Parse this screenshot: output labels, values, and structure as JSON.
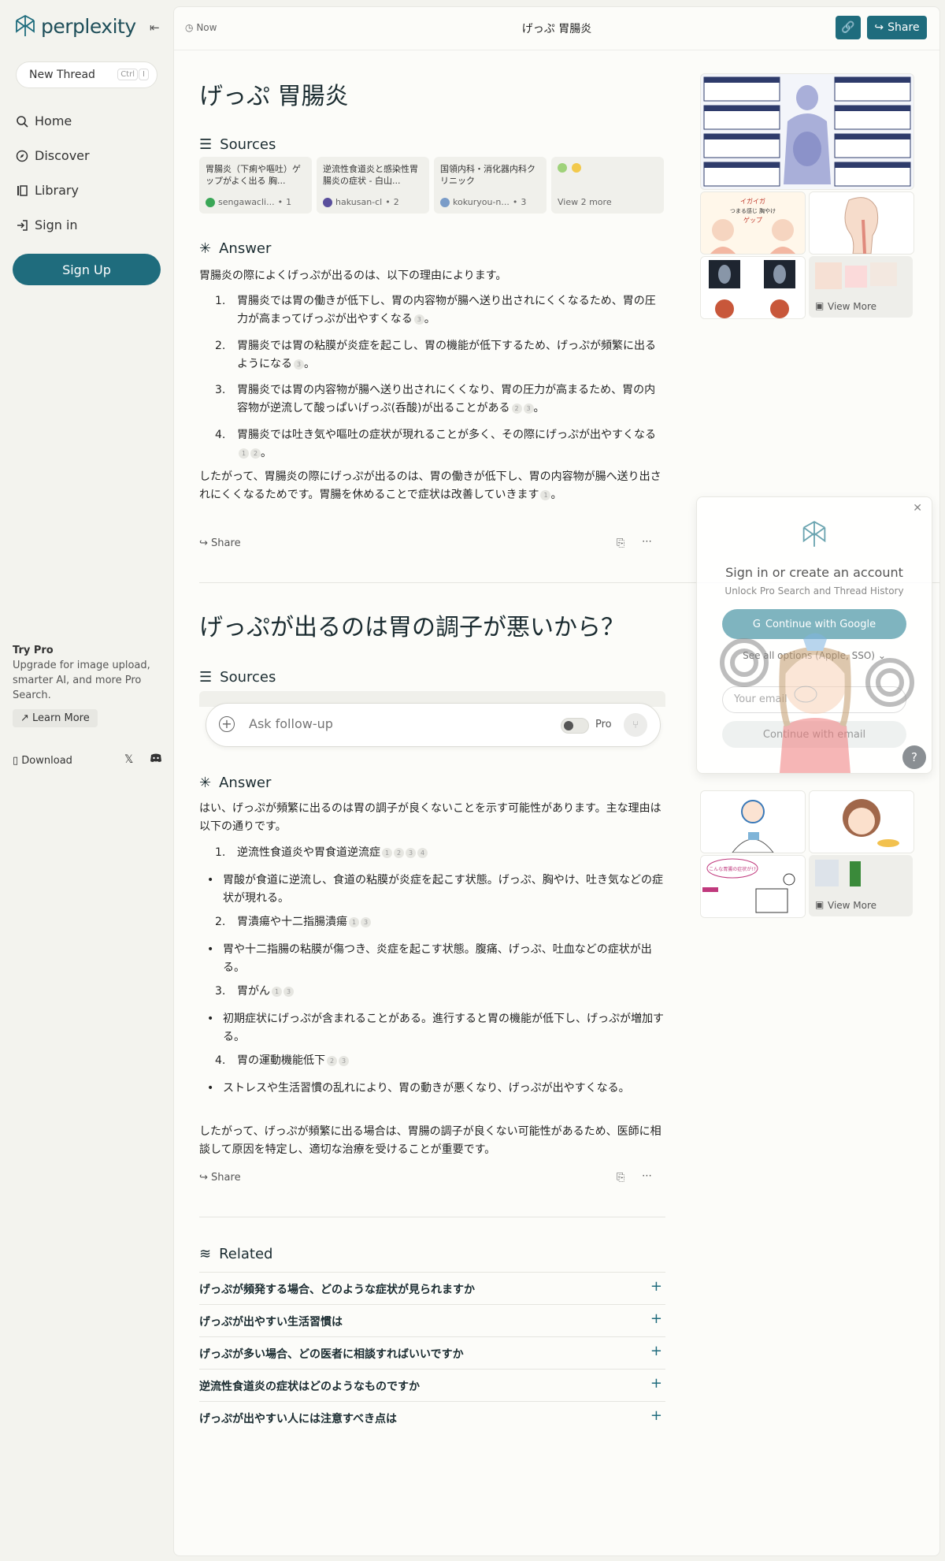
{
  "sidebar": {
    "logo_text": "perplexity",
    "new_thread": "New Thread",
    "shortcut_ctrl": "Ctrl",
    "shortcut_key": "I",
    "nav": [
      "Home",
      "Discover",
      "Library",
      "Sign in"
    ],
    "signup": "Sign Up",
    "try_pro_title": "Try Pro",
    "try_pro_desc": "Upgrade for image upload, smarter AI, and more Pro Search.",
    "learn_more": "Learn More",
    "download": "Download"
  },
  "topbar": {
    "time": "Now",
    "title": "げっぷ 胃腸炎",
    "share": "Share"
  },
  "thread1": {
    "question": "げっぷ 胃腸炎",
    "sources_label": "Sources",
    "sources": [
      {
        "title": "胃腸炎（下痢や嘔吐）ゲップがよく出る 胸...",
        "site": "sengawacli...",
        "num": "1",
        "color": "#3aa757"
      },
      {
        "title": "逆流性食道炎と感染性胃腸炎の症状 - 白山...",
        "site": "hakusan-cl",
        "num": "2",
        "color": "#5a4f9c"
      },
      {
        "title": "国領内科・消化器内科クリニック",
        "site": "kokuryou-n...",
        "num": "3",
        "color": "#7a9cc8"
      }
    ],
    "view_sources": "View 2 more",
    "answer_label": "Answer",
    "intro": "胃腸炎の際によくげっぷが出るのは、以下の理由によります。",
    "items": [
      {
        "n": "1.",
        "text": "胃腸炎では胃の働きが低下し、胃の内容物が腸へ送り出されにくくなるため、胃の圧力が高まってげっぷが出やすくなる",
        "cites": [
          "3"
        ]
      },
      {
        "n": "2.",
        "text": "胃腸炎では胃の粘膜が炎症を起こし、胃の機能が低下するため、げっぷが頻繁に出るようになる",
        "cites": [
          "3"
        ]
      },
      {
        "n": "3.",
        "text": "胃腸炎では胃の内容物が腸へ送り出されにくくなり、胃の圧力が高まるため、胃の内容物が逆流して酸っぱいげっぷ(呑酸)が出ることがある",
        "cites": [
          "2",
          "3"
        ]
      },
      {
        "n": "4.",
        "text": "胃腸炎では吐き気や嘔吐の症状が現れることが多く、その際にげっぷが出やすくなる",
        "cites": [
          "1",
          "2"
        ]
      }
    ],
    "conclusion": "したがって、胃腸炎の際にげっぷが出るのは、胃の働きが低下し、胃の内容物が腸へ送り出されにくくなるためです。胃腸を休めることで症状は改善していきます",
    "conclusion_cite": "1",
    "share": "Share",
    "view_more": "View More"
  },
  "thread2": {
    "question": "げっぷが出るのは胃の調子が悪いから？",
    "sources_label": "Sources",
    "answer_label": "Answer",
    "intro": "はい、げっぷが頻繁に出るのは胃の調子が良くないことを示す可能性があります。主な理由は以下の通りです。",
    "items": [
      {
        "n": "1.",
        "title": "逆流性食道炎や胃食道逆流症",
        "cites": [
          "1",
          "2",
          "3",
          "4"
        ],
        "bullet": "胃酸が食道に逆流し、食道の粘膜が炎症を起こす状態。げっぷ、胸やけ、吐き気などの症状が現れる。"
      },
      {
        "n": "2.",
        "title": "胃潰瘍や十二指腸潰瘍",
        "cites": [
          "1",
          "3"
        ],
        "bullet": "胃や十二指腸の粘膜が傷つき、炎症を起こす状態。腹痛、げっぷ、吐血などの症状が出る。"
      },
      {
        "n": "3.",
        "title": "胃がん",
        "cites": [
          "1",
          "3"
        ],
        "bullet": "初期症状にげっぷが含まれることがある。進行すると胃の機能が低下し、げっぷが増加する。"
      },
      {
        "n": "4.",
        "title": "胃の運動機能低下",
        "cites": [
          "2",
          "3"
        ],
        "bullet": "ストレスや生活習慣の乱れにより、胃の動きが悪くなり、げっぷが出やすくなる。"
      }
    ],
    "conclusion": "したがって、げっぷが頻繁に出る場合は、胃腸の調子が良くない可能性があるため、医師に相談して原因を特定し、適切な治療を受けることが重要です。",
    "share": "Share",
    "view_more": "View More"
  },
  "ask": {
    "placeholder": "Ask follow-up",
    "pro": "Pro"
  },
  "related": {
    "label": "Related",
    "items": [
      "げっぷが頻発する場合、どのような症状が見られますか",
      "げっぷが出やすい生活習慣は",
      "げっぷが多い場合、どの医者に相談すればいいですか",
      "逆流性食道炎の症状はどのようなものですか",
      "げっぷが出やすい人には注意すべき点は"
    ]
  },
  "images": {
    "burp_title": "イガイガ つまる感じ 胸やけ ゲップ 咳 のどが詰まる",
    "cartoon_caption": "こんな胃腸の症状が!?"
  },
  "modal": {
    "title": "Sign in or create an account",
    "subtitle": "Unlock Pro Search and Thread History",
    "google": "Continue with Google",
    "all_options": "See all options (Apple, SSO)",
    "email_placeholder": "Your email",
    "continue_email": "Continue with email"
  },
  "colors": {
    "accent": "#1f6c7d",
    "background": "#f3f3ee",
    "panel": "#fcfcf9"
  }
}
